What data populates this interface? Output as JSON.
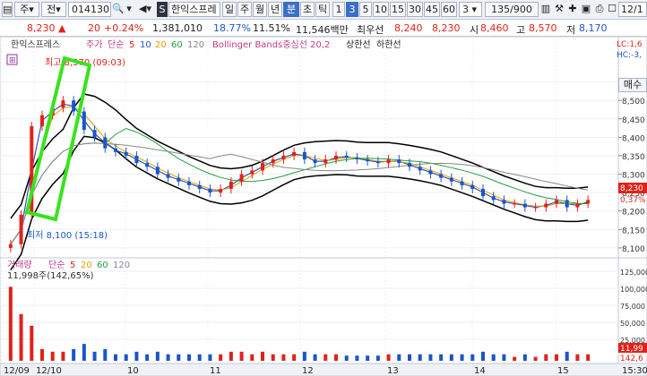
{
  "toolbar": {
    "jongmok_label": "주",
    "jeon_label": "전",
    "code": "014130",
    "stock_name": "한익스프레",
    "periods": [
      "일",
      "주",
      "월",
      "년",
      "분",
      "초",
      "틱"
    ],
    "selected_period": "분",
    "intervals": [
      "1",
      "3",
      "5",
      "10",
      "15",
      "30",
      "45",
      "60"
    ],
    "selected_interval": "3",
    "interval_value": "3",
    "count": "135/900",
    "date": "12/1"
  },
  "quote": {
    "price": "8,230",
    "change": "20",
    "change_pct": "+0.24%",
    "volume": "1,381,010",
    "turnover_ratio": "18.77%",
    "ratio2": "11.51%",
    "amount": "11,546백만",
    "best_bid_label": "최우선",
    "best_bid": "8,240",
    "best_ask": "8,230",
    "open_label": "시",
    "open": "8,460",
    "high_label": "고",
    "high": "8,570",
    "low_label": "저",
    "low": "8,170"
  },
  "price_pane": {
    "legend": {
      "name": "한익스프레스",
      "price_label": "주가",
      "ma_label": "단순",
      "ma_periods": [
        "5",
        "10",
        "20",
        "60",
        "120"
      ],
      "ma_colors": [
        "#e0221b",
        "#1a56c9",
        "#e0a000",
        "#20a040",
        "#888888"
      ],
      "bb_label": "Bollinger Bands중심선 20,2",
      "upper_label": "상한선",
      "lower_label": "하한선"
    },
    "right_labels": [
      "LC:1,6",
      "HC:-3,"
    ],
    "high_annotation": "최고 8,570 (09:03)",
    "low_annotation": "최저 8,100 (15:18)",
    "current_price_tag": "8,230",
    "current_pct_tag": "0,37%",
    "buy_button": "매수",
    "y_axis": {
      "ticks": [
        "8,550",
        "8,500",
        "8,450",
        "8,400",
        "8,350",
        "8,300",
        "8,250",
        "8,200",
        "8,150",
        "8,100"
      ],
      "tick_values": [
        8550,
        8500,
        8450,
        8400,
        8350,
        8300,
        8250,
        8200,
        8150,
        8100
      ],
      "min": 8090,
      "max": 8600
    }
  },
  "volume_pane": {
    "legend": {
      "name": "거래량",
      "ma_label": "단순",
      "ma_periods": [
        "5",
        "20",
        "60",
        "120"
      ]
    },
    "value_label": "11,998주(142,65%)",
    "y_axis": {
      "ticks": [
        "125,000",
        "100,000",
        "75,000",
        "50,000",
        "25,000"
      ]
    },
    "current_tag_1": "11,99",
    "current_tag_2": "142,6"
  },
  "x_axis": {
    "labels": [
      "12/09",
      "12/10",
      "10",
      "11",
      "12",
      "13",
      "14",
      "15",
      "15:30"
    ]
  },
  "chart_data": {
    "type": "candlestick",
    "interval": "3분",
    "price_range": [
      8100,
      8570
    ],
    "annotations": {
      "high": {
        "value": 8570,
        "time": "09:03"
      },
      "low": {
        "value": 8100,
        "time": "15:18"
      }
    },
    "close_approx": [
      8110,
      8190,
      8430,
      8460,
      8480,
      8500,
      8470,
      8420,
      8400,
      8370,
      8360,
      8350,
      8330,
      8320,
      8300,
      8290,
      8280,
      8270,
      8260,
      8250,
      8260,
      8280,
      8300,
      8310,
      8330,
      8340,
      8350,
      8360,
      8340,
      8330,
      8340,
      8350,
      8345,
      8340,
      8335,
      8330,
      8340,
      8330,
      8320,
      8310,
      8300,
      8290,
      8280,
      8270,
      8260,
      8240,
      8230,
      8220,
      8220,
      8210,
      8210,
      8220,
      8230,
      8210,
      8220,
      8230
    ]
  }
}
